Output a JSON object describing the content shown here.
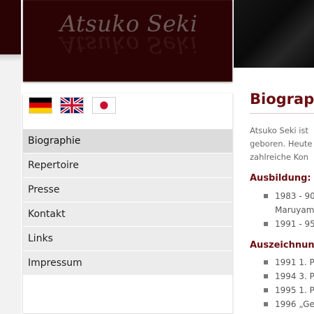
{
  "banner": {
    "title": "Atsuko Seki"
  },
  "languages": [
    {
      "code": "de",
      "icon": "german-flag-icon"
    },
    {
      "code": "en",
      "icon": "uk-flag-icon"
    },
    {
      "code": "ja",
      "icon": "japanese-flag-icon"
    }
  ],
  "menu": {
    "items": [
      {
        "label": "Biographie",
        "active": true
      },
      {
        "label": "Repertoire"
      },
      {
        "label": "Presse"
      },
      {
        "label": "Kontakt"
      },
      {
        "label": "Links"
      },
      {
        "label": "Impressum"
      }
    ]
  },
  "main": {
    "title": "Biograph",
    "intro": [
      "Atsuko Seki ist",
      "geboren. Heute",
      "zahlreiche Kon"
    ],
    "sections": [
      {
        "heading": "Ausbildung:",
        "items": [
          {
            "line1": "1983 - 90",
            "line2": "Maruyam"
          },
          {
            "line1": "1991 - 95"
          }
        ]
      },
      {
        "heading": "Auszeichnunge",
        "items": [
          {
            "line1": "1991 1. P"
          },
          {
            "line1": "1994 3. P"
          },
          {
            "line1": "1995 1. P"
          },
          {
            "line1": "1996 „Ge"
          }
        ]
      }
    ]
  },
  "colors": {
    "banner_bg": "#2c0305",
    "accent": "#6b0f13",
    "menu_bg": "#ececec",
    "menu_active_bg": "#dcdcdc"
  }
}
